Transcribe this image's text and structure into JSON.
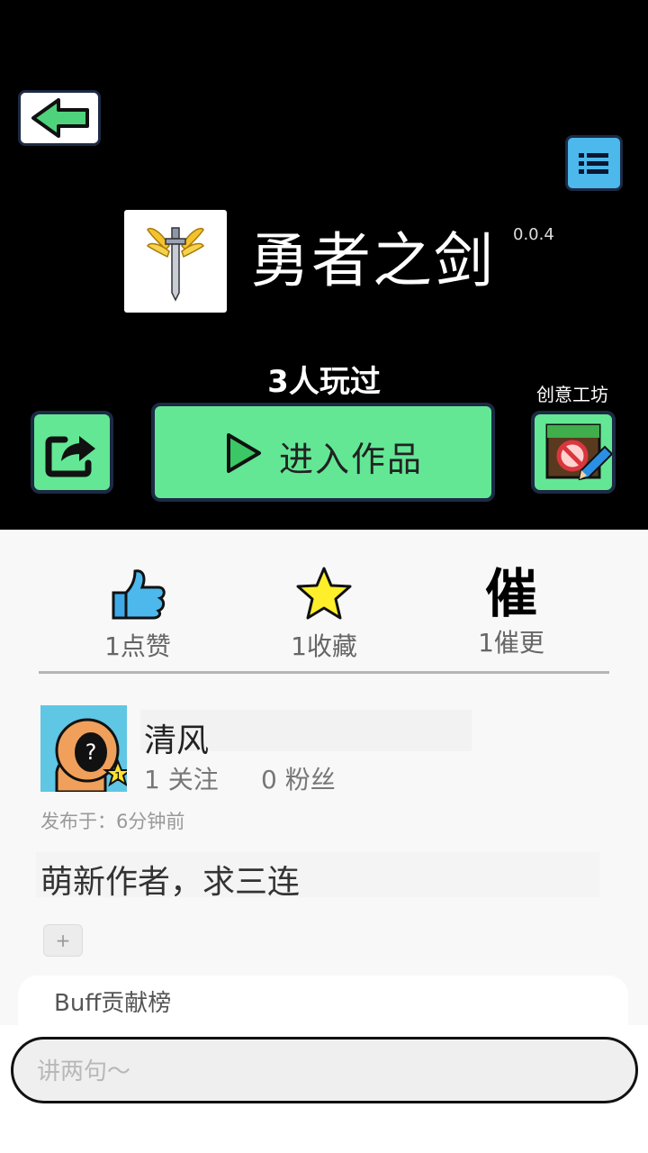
{
  "game": {
    "title": "勇者之剑",
    "version": "0.0.4",
    "played": "3人玩过",
    "enter_label": "进入作品",
    "workshop_label": "创意工坊"
  },
  "stats": {
    "likes": "1点赞",
    "favorites": "1收藏",
    "urge_icon_text": "催",
    "urge": "1催更"
  },
  "author": {
    "name": "清风",
    "follow": "1 关注",
    "fans": "0 粉丝",
    "level": "1"
  },
  "post": {
    "published": "发布于：6分钟前",
    "description": "萌新作者，求三连",
    "plus": "+"
  },
  "buff": {
    "title": "Buff贡献榜"
  },
  "comment": {
    "placeholder": "讲两句～"
  },
  "colors": {
    "accent_green": "#63e795",
    "menu_blue": "#4cb8ec",
    "border_navy": "#1d2a44"
  }
}
